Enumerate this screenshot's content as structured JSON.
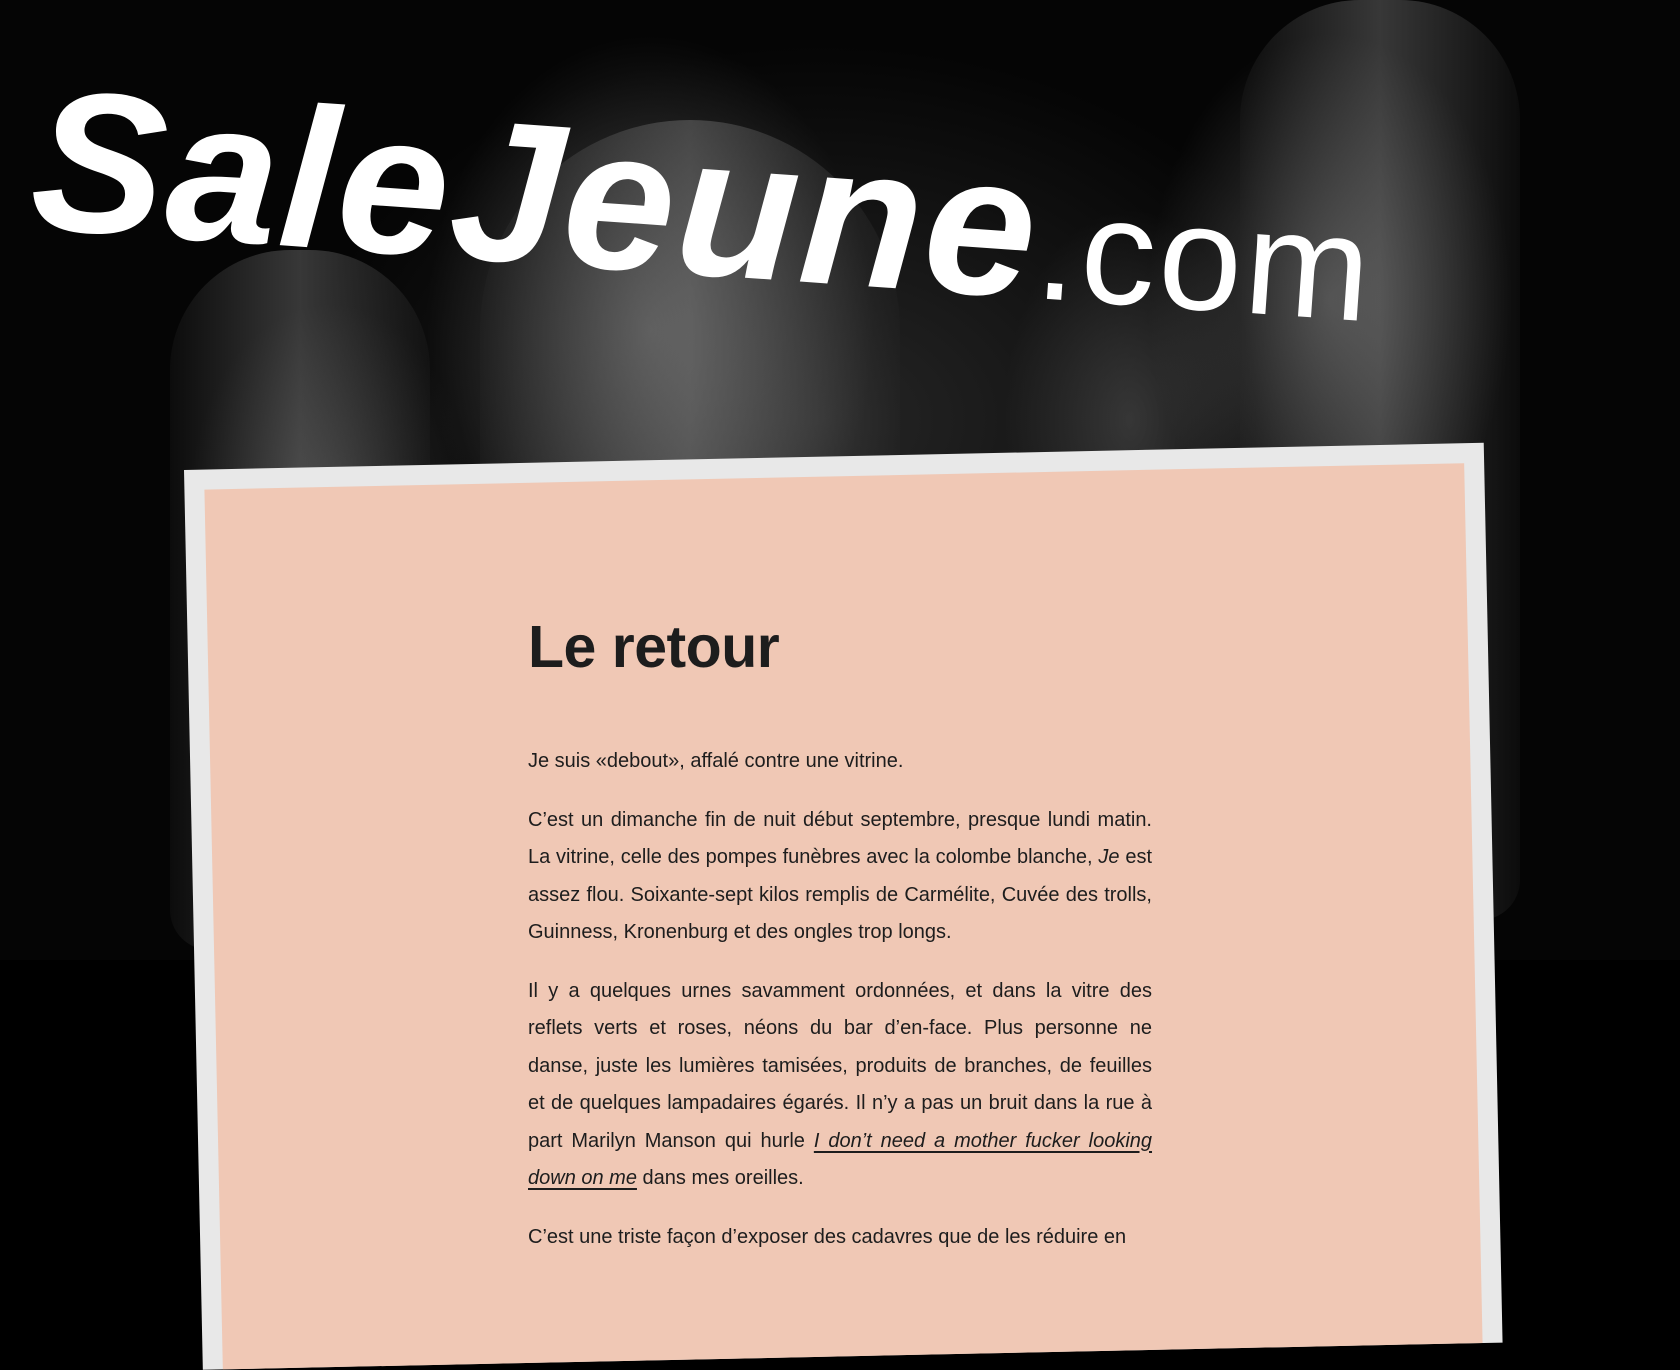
{
  "site": {
    "name": "SaleJeune",
    "tld": ".com"
  },
  "article": {
    "title": "Le retour",
    "paragraphs": {
      "p1": "Je suis «debout», affalé contre une vitrine.",
      "p2_before": "C’est un dimanche fin de nuit début septembre, presque lundi matin. La vitrine, celle des pompes funèbres avec la colombe blanche, ",
      "p2_em": "Je",
      "p2_after": " est assez flou. Soixante-sept kilos remplis de Carmélite, Cuvée des trolls, Guinness, Kronenburg et des ongles trop longs.",
      "p3_before": "Il y a quelques urnes savamment ordonnées, et dans la vitre des re­flets verts et roses, néons du bar d’en-face. Plus personne ne danse, juste les lumières tamisées, produits de branches, de feuilles et de quelques lampadaires égarés. Il n’y a pas un bruit dans la rue à part Marilyn Manson qui hurle ",
      "p3_link": "I don’t need a mother fucker looking down on me",
      "p3_after": " dans mes oreilles.",
      "p4": "C’est une triste façon d’exposer des cadavres que de les réduire en"
    }
  },
  "colors": {
    "card_frame": "#e8e8e8",
    "card_fill": "#f0c4b0",
    "text": "#1d1d1d",
    "title": "#ffffff"
  }
}
